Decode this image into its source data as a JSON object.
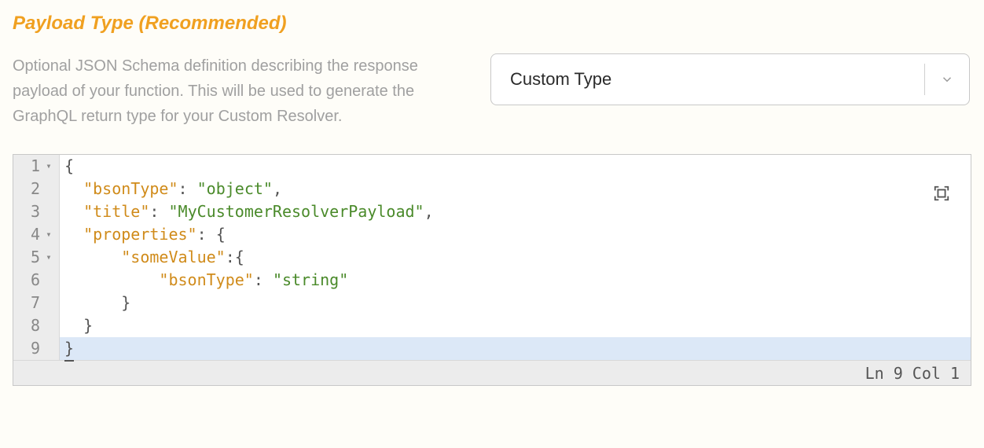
{
  "section": {
    "title": "Payload Type (Recommended)",
    "description": "Optional JSON Schema definition describing the response payload of your function. This will be used to generate the GraphQL return type for your Custom Resolver."
  },
  "typeSelect": {
    "value": "Custom Type"
  },
  "editor": {
    "lines": [
      {
        "num": "1",
        "foldable": true,
        "tokens": [
          {
            "t": "brace",
            "v": "{"
          }
        ]
      },
      {
        "num": "2",
        "foldable": false,
        "tokens": [
          {
            "t": "indent",
            "v": "  "
          },
          {
            "t": "key",
            "v": "\"bsonType\""
          },
          {
            "t": "colon",
            "v": ": "
          },
          {
            "t": "string",
            "v": "\"object\""
          },
          {
            "t": "comma",
            "v": ","
          }
        ]
      },
      {
        "num": "3",
        "foldable": false,
        "tokens": [
          {
            "t": "indent",
            "v": "  "
          },
          {
            "t": "key",
            "v": "\"title\""
          },
          {
            "t": "colon",
            "v": ": "
          },
          {
            "t": "string",
            "v": "\"MyCustomerResolverPayload\""
          },
          {
            "t": "comma",
            "v": ","
          }
        ]
      },
      {
        "num": "4",
        "foldable": true,
        "tokens": [
          {
            "t": "indent",
            "v": "  "
          },
          {
            "t": "key",
            "v": "\"properties\""
          },
          {
            "t": "colon",
            "v": ": "
          },
          {
            "t": "brace",
            "v": "{"
          }
        ]
      },
      {
        "num": "5",
        "foldable": true,
        "tokens": [
          {
            "t": "indent",
            "v": "      "
          },
          {
            "t": "key",
            "v": "\"someValue\""
          },
          {
            "t": "colon",
            "v": ":"
          },
          {
            "t": "brace",
            "v": "{"
          }
        ]
      },
      {
        "num": "6",
        "foldable": false,
        "tokens": [
          {
            "t": "indent",
            "v": "          "
          },
          {
            "t": "key",
            "v": "\"bsonType\""
          },
          {
            "t": "colon",
            "v": ": "
          },
          {
            "t": "string",
            "v": "\"string\""
          }
        ]
      },
      {
        "num": "7",
        "foldable": false,
        "tokens": [
          {
            "t": "indent",
            "v": "      "
          },
          {
            "t": "brace",
            "v": "}"
          }
        ]
      },
      {
        "num": "8",
        "foldable": false,
        "tokens": [
          {
            "t": "indent",
            "v": "  "
          },
          {
            "t": "brace",
            "v": "}"
          }
        ]
      },
      {
        "num": "9",
        "foldable": false,
        "active": true,
        "tokens": [
          {
            "t": "brace",
            "v": "}",
            "cursor": true
          }
        ]
      }
    ],
    "status": "Ln 9 Col 1"
  }
}
